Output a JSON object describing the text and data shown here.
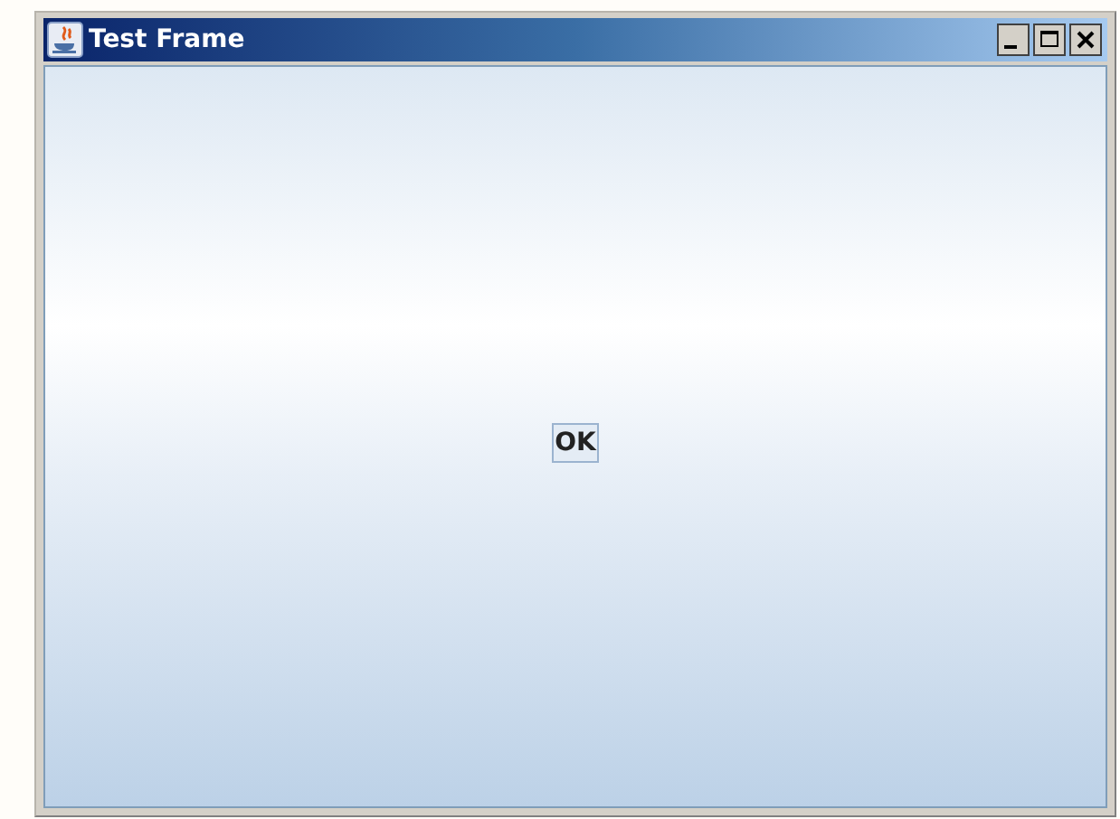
{
  "window": {
    "title": "Test Frame"
  },
  "button": {
    "label": "OK"
  }
}
